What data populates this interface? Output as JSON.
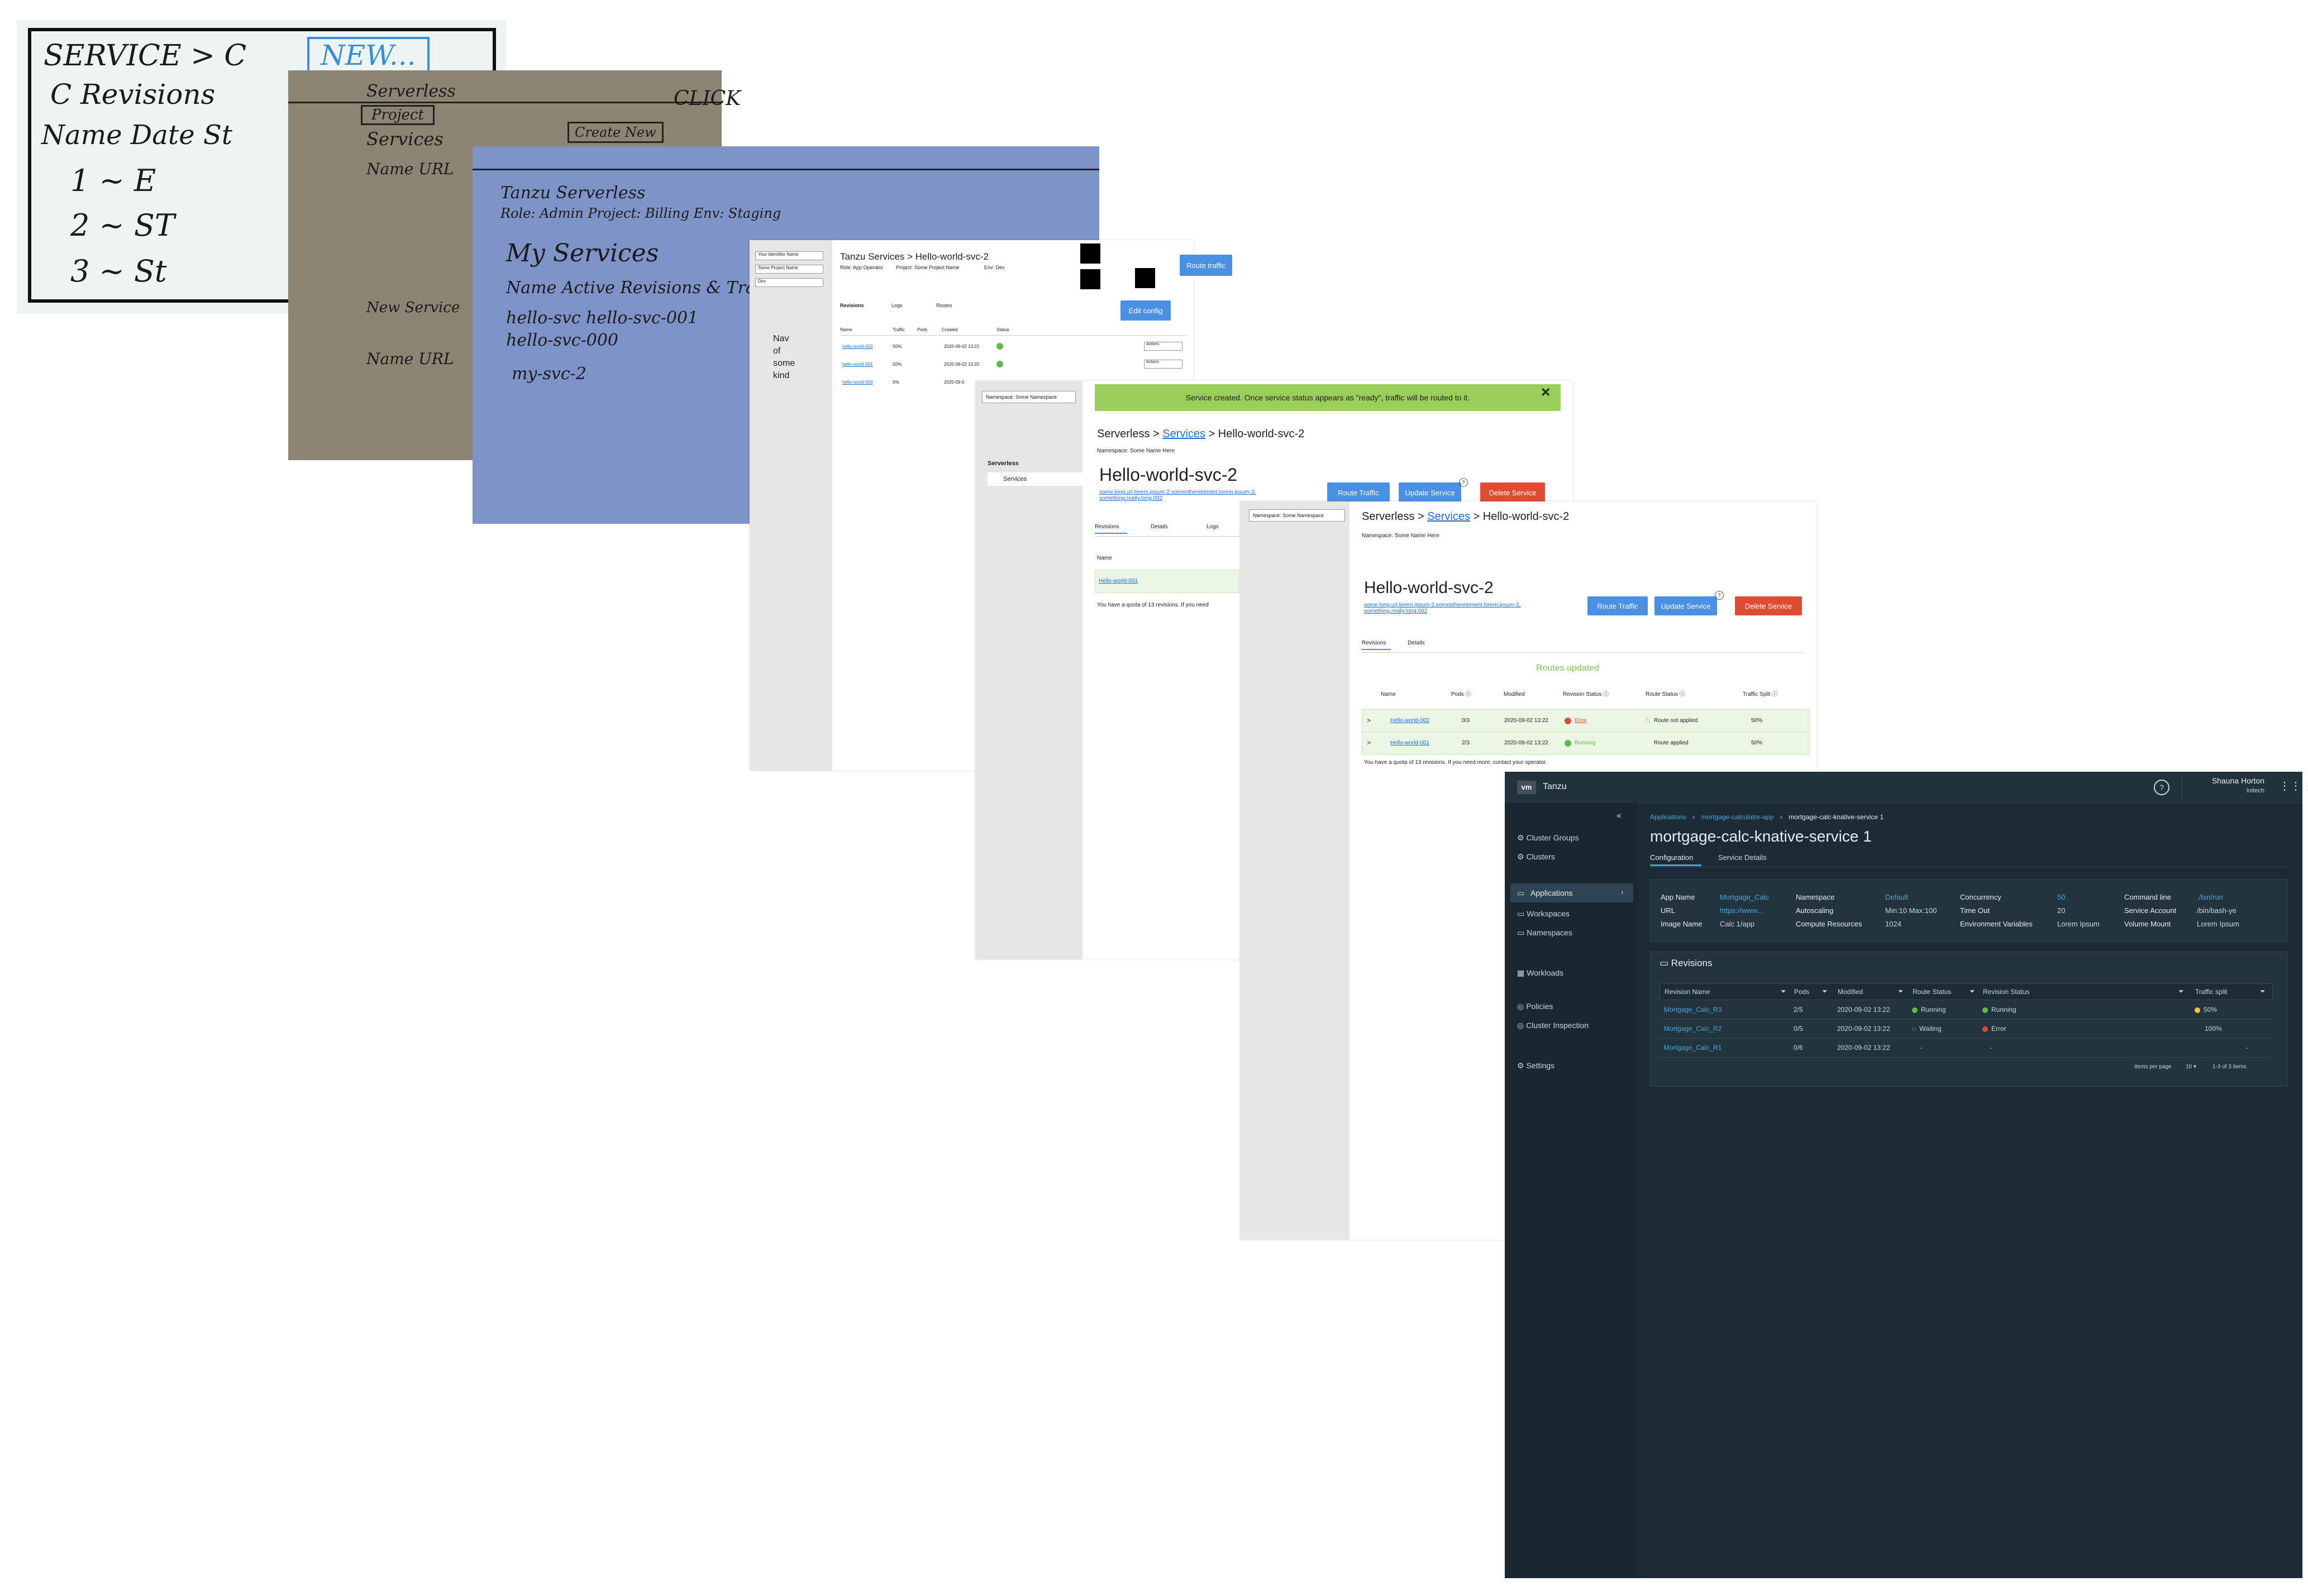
{
  "sketch1": {
    "lines": [
      "SERVICE > C",
      "C  Revisions",
      "Name   Date  St",
      "1    ~   E",
      "2    ~   ST",
      "3    ~   St"
    ],
    "button": "NEW..."
  },
  "sketch2": {
    "lines": [
      "Serverless",
      "Project",
      "Services",
      "Name  URL",
      "New Service",
      "Name  URL"
    ],
    "button": "Create New",
    "note": "CLICK"
  },
  "sketch3": {
    "lines": [
      "Tanzu Serverless",
      "Role: Admin   Project: Billing   Env: Staging",
      "My Services",
      "Name    Active Revisions & Traffic",
      "hello-svc    hello-svc-001",
      "           hello-svc-000",
      "my-svc-2"
    ]
  },
  "wire1": {
    "selects": [
      "Your Identifier Name",
      "Some Project Name",
      "Dev"
    ],
    "nav_text": [
      "Nav",
      "of",
      "some",
      "kind"
    ],
    "title": "Tanzu Services  > Hello-world-svc-2",
    "meta": [
      "Role: App Operator",
      "Project: Some Project Name",
      "Env: Dev"
    ],
    "route_button": "Route traffic",
    "edit_button": "Edit config",
    "tabs": [
      "Revisions",
      "Logs",
      "Routes"
    ],
    "headers": [
      "Name",
      "Traffic",
      "Pods",
      "Created",
      "Status"
    ],
    "rows": [
      {
        "name": "hello-world-002",
        "traffic": "50%",
        "created": "2020-09-02 13:22"
      },
      {
        "name": "hello-world-001",
        "traffic": "50%",
        "created": "2020-09-02 13:20"
      },
      {
        "name": "hello-world-000",
        "traffic": "0%",
        "created": "2020-09-0"
      }
    ],
    "actions": "Actions"
  },
  "wire2": {
    "namespace": "Namespace: Some Namespace",
    "side_section": "Serverless",
    "side_item": "Services",
    "banner": "Service created. Once service status appears as \"ready\", traffic will be routed to it.",
    "breadcrumb_pre": "Serverless > ",
    "breadcrumb_link": "Services",
    "breadcrumb_post": " > Hello-world-svc-2",
    "namespace_line": "Namespace: Some Name Here",
    "title": "Hello-world-svc-2",
    "url": "some.long.url.lorem.ipsum-2.someotherelement.lorem.ipsum-2. something.really.long.002",
    "buttons": [
      "Route Traffic",
      "Update Service",
      "Delete Service"
    ],
    "tabs": [
      "Revisions",
      "Details",
      "Logs"
    ],
    "col": "Name",
    "row": "Hello-world-001",
    "quota": "You have a quota of 13 revisions. If you need"
  },
  "wire3": {
    "namespace": "Namespace: Some Namespace",
    "breadcrumb_pre": "Serverless > ",
    "breadcrumb_link": "Services",
    "breadcrumb_post": " > Hello-world-svc-2",
    "namespace_line": "Namespace: Some Name Here",
    "title": "Hello-world-svc-2",
    "url": "some.long.url.lorem.ipsum-2.someotherelement.lorem.ipsum-2. something.really.long.002",
    "buttons": [
      "Route Traffic",
      "Update Service",
      "Delete Service"
    ],
    "tabs": [
      "Revisions",
      "Details"
    ],
    "notice": "Routes updated",
    "headers": [
      "Name",
      "Pods",
      "Modified",
      "Revision Status",
      "Route Status",
      "Traffic Split"
    ],
    "rows": [
      {
        "name": "Hello-world-002",
        "pods": "0/3",
        "modified": "2020-09-02 13:22",
        "rev_status": "Error",
        "route_status": "Route not applied",
        "split": "50%"
      },
      {
        "name": "Hello-world-001",
        "pods": "2/3",
        "modified": "2020-09-02 13:22",
        "rev_status": "Running",
        "route_status": "Route applied",
        "split": "50%"
      }
    ],
    "quota": "You have a quota of 13 revisions. If you need more, contact your operator."
  },
  "app": {
    "brand": "Tanzu",
    "logo": "vm",
    "user": "Shauna Horton",
    "org": "Initech",
    "nav": [
      "Cluster Groups",
      "Clusters",
      "Applications",
      "Workspaces",
      "Namespaces",
      "Workloads",
      "Policies",
      "Cluster Inspection",
      "Settings"
    ],
    "breadcrumb": [
      "Applications",
      "mortgage-calculator-app",
      "mortgage-calc-knative-service 1"
    ],
    "title": "mortgage-calc-knative-service 1",
    "tabs": [
      "Configuration",
      "Service Details"
    ],
    "config": [
      [
        {
          "k": "App Name",
          "v": "Mortgage_Calc",
          "link": true
        },
        {
          "k": "Namespace",
          "v": "Default",
          "link": true
        },
        {
          "k": "Concurrency",
          "v": "50",
          "link": true
        },
        {
          "k": "Command line",
          "v": "./bin/run",
          "link": true
        }
      ],
      [
        {
          "k": "URL",
          "v": "https://www...",
          "link": true
        },
        {
          "k": "Autoscaling",
          "v": "Min:10 Max:100",
          "link": false
        },
        {
          "k": "Time Out",
          "v": "20",
          "link": false
        },
        {
          "k": "Service Account",
          "v": "/bin/bash-ye",
          "link": false
        }
      ],
      [
        {
          "k": "Image Name",
          "v": "Calc 1/app",
          "link": false
        },
        {
          "k": "Compute Resources",
          "v": "1024",
          "link": false
        },
        {
          "k": "Environment Variables",
          "v": "Lorem Ipsum",
          "link": false
        },
        {
          "k": "Volume Mount",
          "v": "Lorem Ipsum",
          "link": false
        }
      ]
    ],
    "revisions_title": "Revisions",
    "headers": [
      "Revision Name",
      "Pods",
      "Modified",
      "Route Status",
      "Revision Status",
      "Traffic split"
    ],
    "rows": [
      {
        "name": "Mortgage_Calc_R3",
        "pods": "2/5",
        "modified": "2020-09-02 13:22",
        "route": "Running",
        "rev": "Running",
        "split": "50%"
      },
      {
        "name": "Mortgage_Calc_R2",
        "pods": "0/5",
        "modified": "2020-09-02 13:22",
        "route": "Waiting",
        "rev": "Error",
        "split": "100%"
      },
      {
        "name": "Mortgage_Calc_R1",
        "pods": "0/6",
        "modified": "2020-09-02 13:22",
        "route": "-",
        "rev": "-",
        "split": "-"
      }
    ],
    "pager": {
      "label": "Items per page",
      "value": "10",
      "range": "1-3 of 3 items"
    },
    "colors": {
      "bg": "#1c2b35",
      "accent": "#4aa8d8",
      "running": "#5dbb4a",
      "error": "#e04b34",
      "warn": "#f5c342"
    }
  }
}
